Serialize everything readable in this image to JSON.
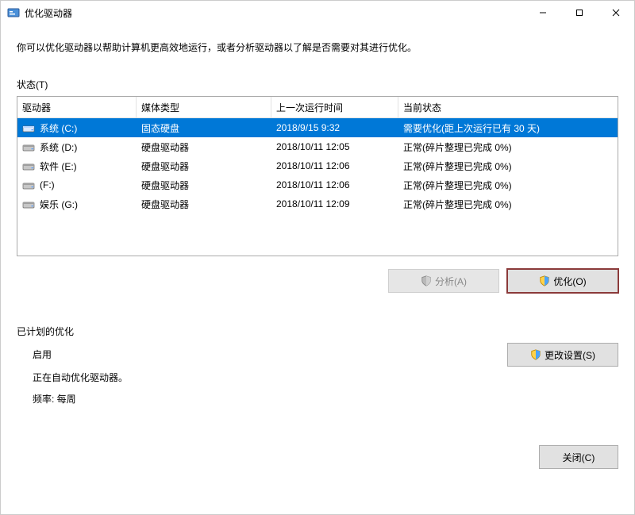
{
  "window": {
    "title": "优化驱动器"
  },
  "description": "你可以优化驱动器以帮助计算机更高效地运行，或者分析驱动器以了解是否需要对其进行优化。",
  "status_label": "状态(T)",
  "columns": {
    "drive": "驱动器",
    "media": "媒体类型",
    "last": "上一次运行时间",
    "status": "当前状态"
  },
  "drives": [
    {
      "name": "系统 (C:)",
      "media": "固态硬盘",
      "last": "2018/9/15 9:32",
      "status": "需要优化(距上次运行已有 30 天)",
      "selected": true
    },
    {
      "name": "系统 (D:)",
      "media": "硬盘驱动器",
      "last": "2018/10/11 12:05",
      "status": "正常(碎片整理已完成 0%)",
      "selected": false
    },
    {
      "name": "软件 (E:)",
      "media": "硬盘驱动器",
      "last": "2018/10/11 12:06",
      "status": "正常(碎片整理已完成 0%)",
      "selected": false
    },
    {
      "name": "(F:)",
      "media": "硬盘驱动器",
      "last": "2018/10/11 12:06",
      "status": "正常(碎片整理已完成 0%)",
      "selected": false
    },
    {
      "name": "娱乐 (G:)",
      "media": "硬盘驱动器",
      "last": "2018/10/11 12:09",
      "status": "正常(碎片整理已完成 0%)",
      "selected": false
    }
  ],
  "buttons": {
    "analyze": "分析(A)",
    "optimize": "优化(O)",
    "change_settings": "更改设置(S)",
    "close": "关闭(C)"
  },
  "schedule": {
    "section_label": "已计划的优化",
    "enabled_label": "启用",
    "status_text": "正在自动优化驱动器。",
    "frequency_text": "频率: 每周"
  }
}
